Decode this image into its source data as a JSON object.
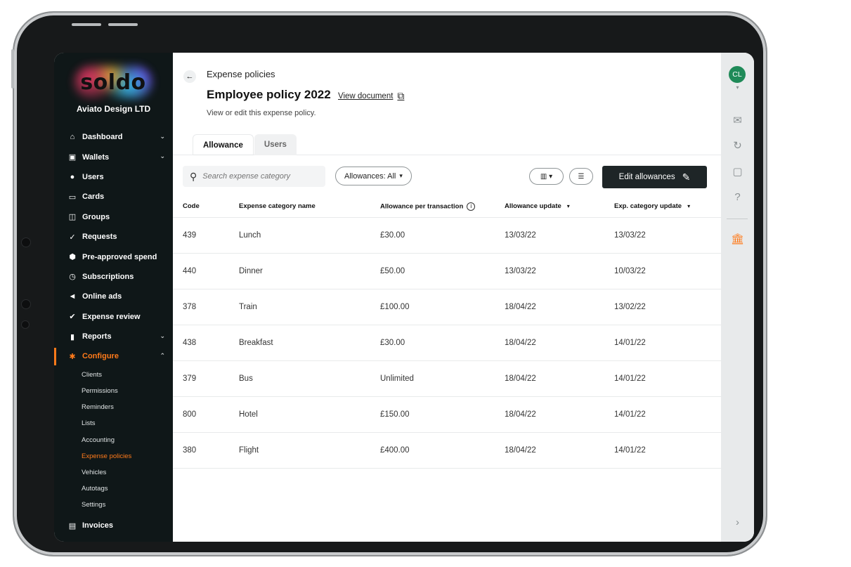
{
  "sidebar": {
    "logo_text": "soldo",
    "company": "Aviato Design LTD",
    "nav": [
      {
        "label": "Dashboard",
        "icon": "⌂",
        "icon_name": "home-icon",
        "chevron": "⌄"
      },
      {
        "label": "Wallets",
        "icon": "▣",
        "icon_name": "wallet-icon",
        "chevron": "⌄"
      },
      {
        "label": "Users",
        "icon": "●",
        "icon_name": "user-icon",
        "chevron": ""
      },
      {
        "label": "Cards",
        "icon": "▭",
        "icon_name": "cards-icon",
        "chevron": ""
      },
      {
        "label": "Groups",
        "icon": "◫",
        "icon_name": "groups-icon",
        "chevron": ""
      },
      {
        "label": "Requests",
        "icon": "✓",
        "icon_name": "requests-icon",
        "chevron": ""
      },
      {
        "label": "Pre-approved spend",
        "icon": "⬢",
        "icon_name": "shield-icon",
        "chevron": ""
      },
      {
        "label": "Subscriptions",
        "icon": "◷",
        "icon_name": "clock-icon",
        "chevron": ""
      },
      {
        "label": "Online ads",
        "icon": "◄",
        "icon_name": "megaphone-icon",
        "chevron": ""
      },
      {
        "label": "Expense review",
        "icon": "✔",
        "icon_name": "check-icon",
        "chevron": ""
      },
      {
        "label": "Reports",
        "icon": "▮",
        "icon_name": "bar-chart-icon",
        "chevron": "⌄"
      },
      {
        "label": "Configure",
        "icon": "✱",
        "icon_name": "gear-icon",
        "chevron": "⌃"
      }
    ],
    "configure_sub": [
      "Clients",
      "Permissions",
      "Reminders",
      "Lists",
      "Accounting",
      "Expense policies",
      "Vehicles",
      "Autotags",
      "Settings"
    ],
    "invoices_label": "Invoices",
    "invoices_icon": "▤"
  },
  "header": {
    "back_icon": "←",
    "breadcrumb": "Expense policies",
    "title": "Employee policy 2022",
    "view_document": "View document",
    "external_icon": "⧉",
    "subtitle": "View or edit this expense policy."
  },
  "tabs": [
    {
      "label": "Allowance",
      "active": true
    },
    {
      "label": "Users",
      "active": false
    }
  ],
  "toolbar": {
    "search_icon": "⚲",
    "search_placeholder": "Search expense category",
    "filter_label": "Allowances: All",
    "filter_caret": "▾",
    "columns_icon": "▥ ▾",
    "density_icon": "☰",
    "edit_label": "Edit allowances",
    "edit_icon": "✎"
  },
  "table": {
    "columns": [
      {
        "label": "Code"
      },
      {
        "label": "Expense category name"
      },
      {
        "label": "Allowance per transaction",
        "info": "i"
      },
      {
        "label": "Allowance update",
        "sort": "▾"
      },
      {
        "label": "Exp. category update",
        "sort": "▾"
      }
    ],
    "rows": [
      [
        "439",
        "Lunch",
        "£30.00",
        "13/03/22",
        "13/03/22"
      ],
      [
        "440",
        "Dinner",
        "£50.00",
        "13/03/22",
        "10/03/22"
      ],
      [
        "378",
        "Train",
        "£100.00",
        "18/04/22",
        "13/02/22"
      ],
      [
        "438",
        "Breakfast",
        "£30.00",
        "18/04/22",
        "14/01/22"
      ],
      [
        "379",
        "Bus",
        "Unlimited",
        "18/04/22",
        "14/01/22"
      ],
      [
        "800",
        "Hotel",
        "£150.00",
        "18/04/22",
        "14/01/22"
      ],
      [
        "380",
        "Flight",
        "£400.00",
        "18/04/22",
        "14/01/22"
      ]
    ]
  },
  "rail": {
    "avatar": "CL",
    "avatar_caret": "▾",
    "icons": [
      {
        "glyph": "✉",
        "name": "mail-icon"
      },
      {
        "glyph": "↻",
        "name": "refresh-icon"
      },
      {
        "glyph": "▢",
        "name": "chat-icon"
      },
      {
        "glyph": "?",
        "name": "help-icon"
      },
      {
        "glyph": "🏛",
        "name": "bank-icon"
      }
    ],
    "expand_icon": "›"
  },
  "colors": {
    "accent": "#ff7a1a",
    "sidebar_bg": "#0f1718",
    "avatar": "#1f8a58",
    "primary_button": "#1e2527"
  }
}
